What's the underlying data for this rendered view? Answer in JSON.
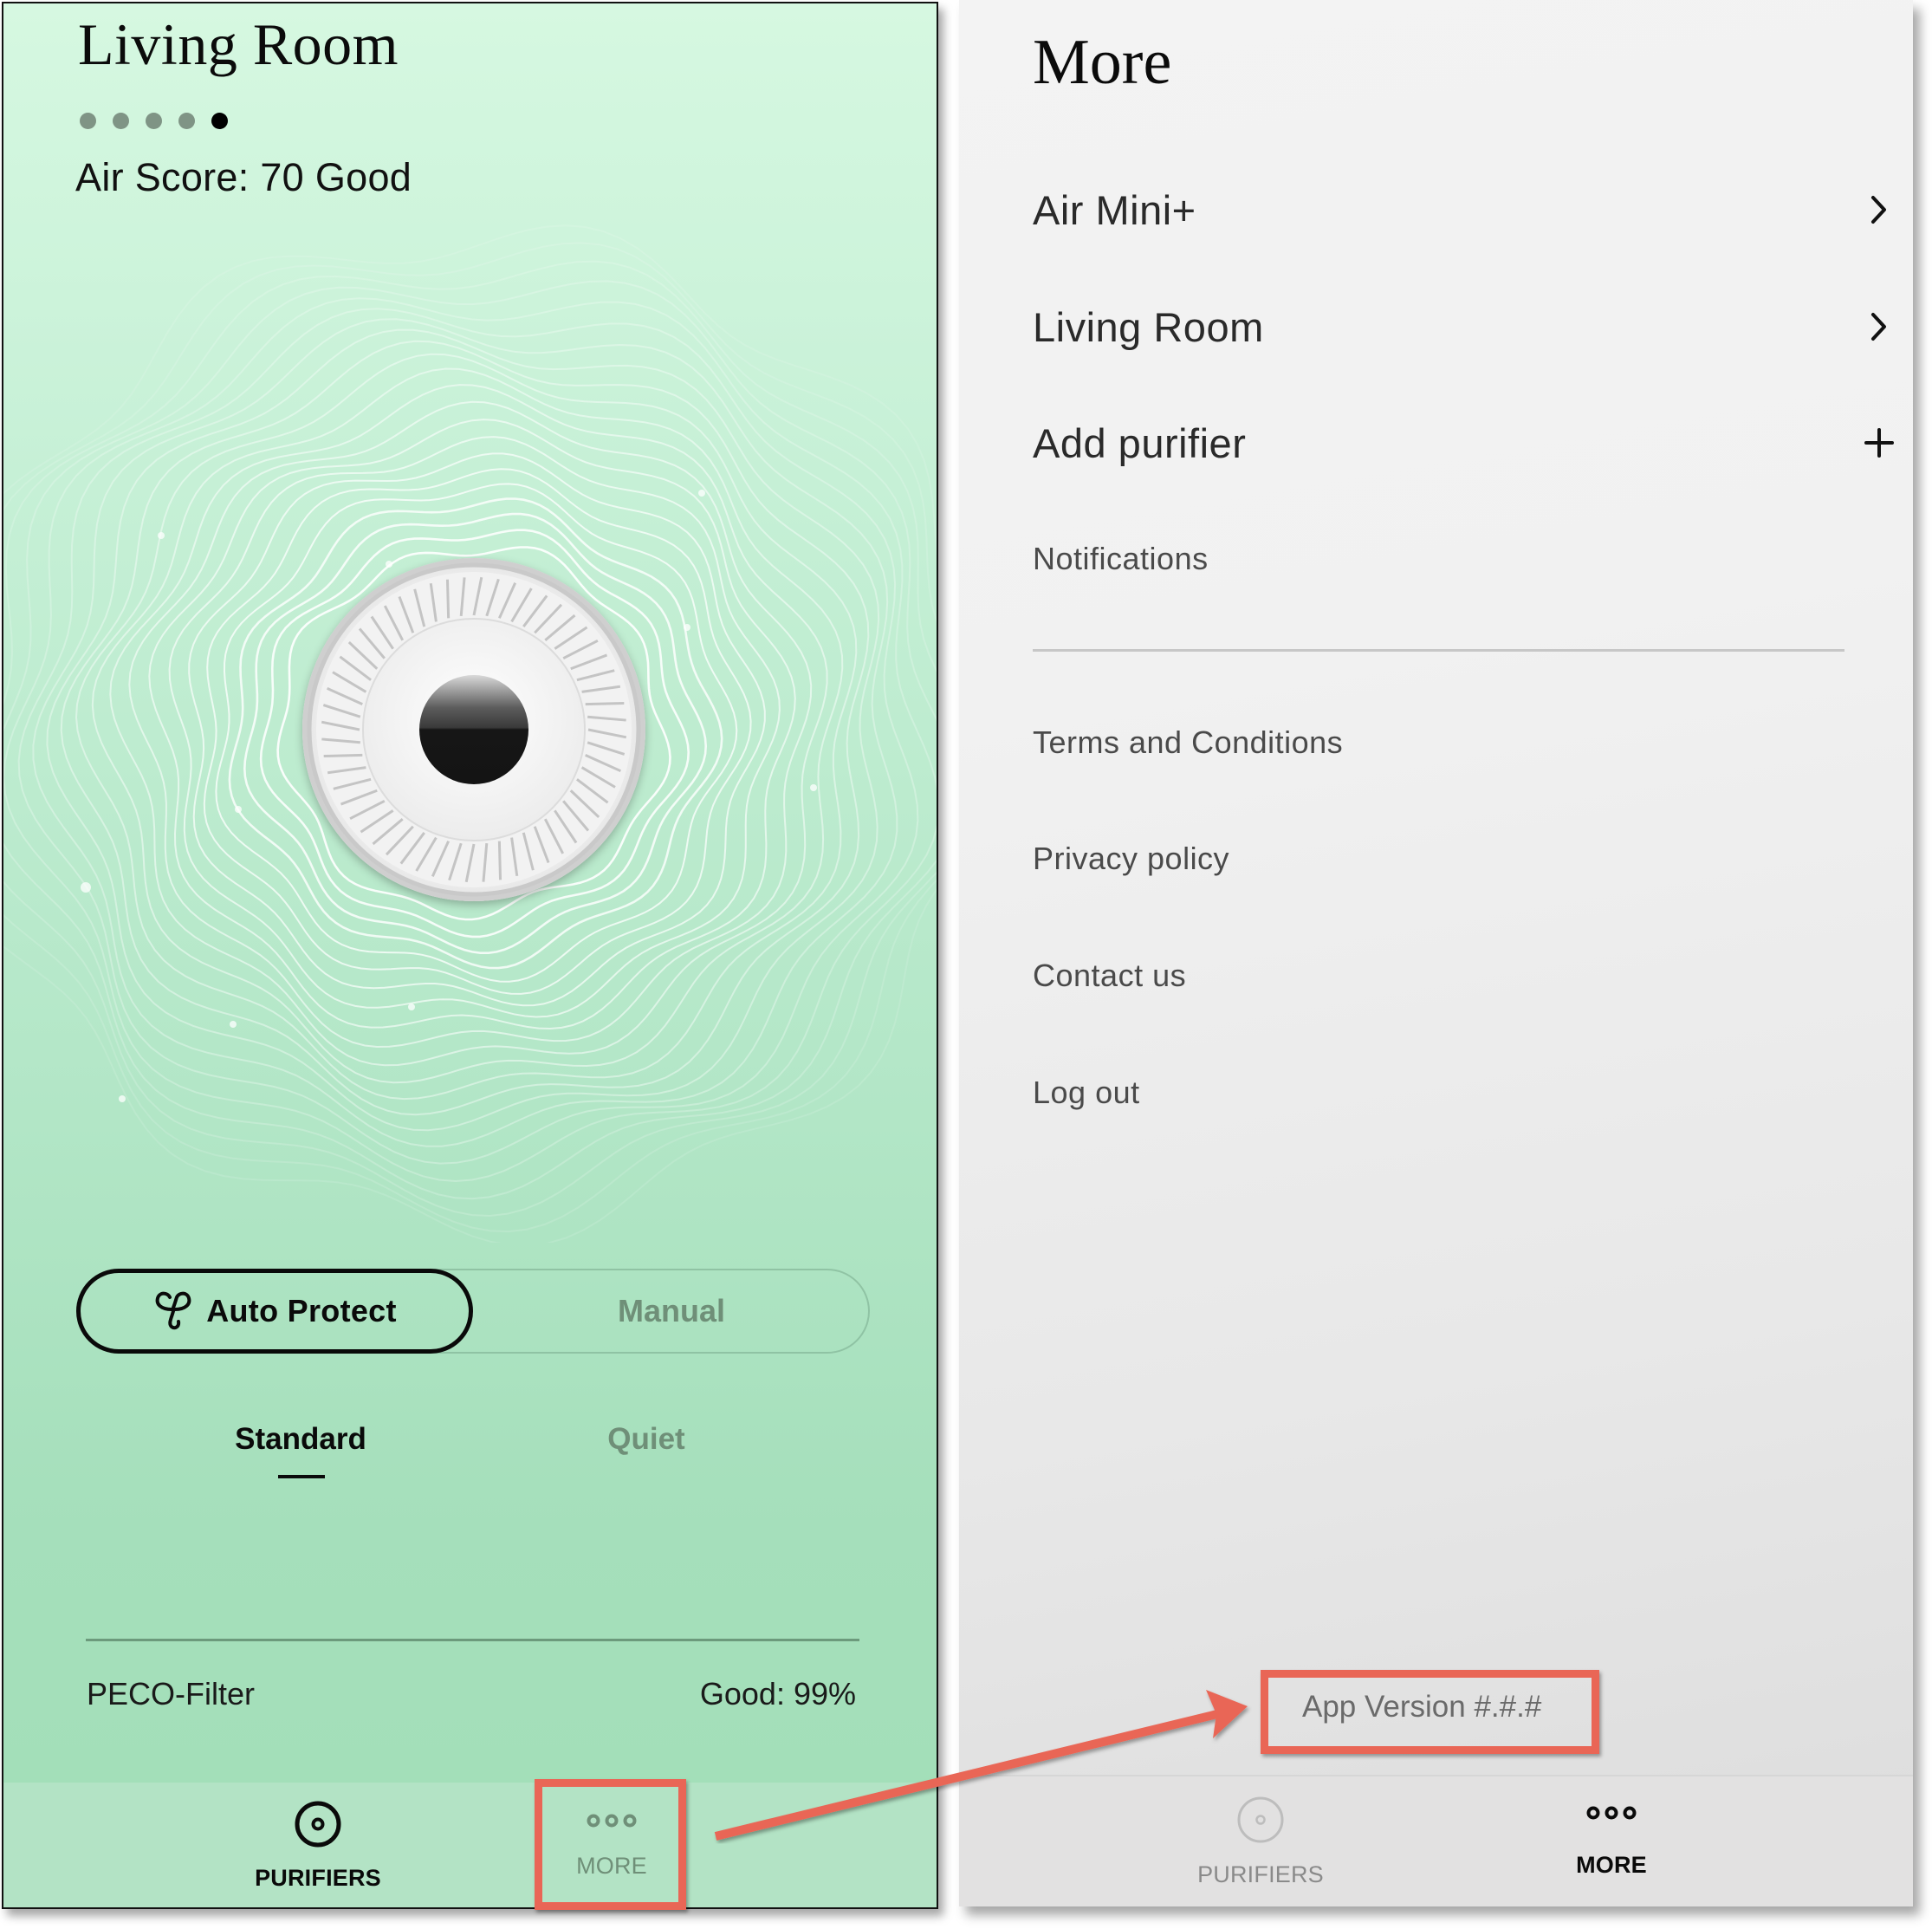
{
  "left_screen": {
    "room_title": "Living Room",
    "page_indicator": {
      "total": 5,
      "active_index": 4
    },
    "air_score_text": "Air Score: 70 Good",
    "air_score": {
      "label": "Air Score",
      "value": 70,
      "rating": "Good"
    },
    "mode_toggle": {
      "options": [
        {
          "label": "Auto Protect",
          "icon": "auto-protect-icon",
          "selected": true
        },
        {
          "label": "Manual",
          "selected": false
        }
      ]
    },
    "fan_tabs": [
      {
        "label": "Standard",
        "selected": true
      },
      {
        "label": "Quiet",
        "selected": false
      }
    ],
    "filter": {
      "name": "PECO-Filter",
      "status": "Good: 99%",
      "percent": 99
    },
    "bottom_nav": [
      {
        "label": "PURIFIERS",
        "icon": "purifier-target-icon",
        "active": true
      },
      {
        "label": "MORE",
        "icon": "more-dots-icon",
        "active": false
      }
    ]
  },
  "right_screen": {
    "title": "More",
    "device_items": [
      {
        "label": "Air Mini+",
        "icon": "chevron-right-icon"
      },
      {
        "label": "Living Room",
        "icon": "chevron-right-icon"
      },
      {
        "label": "Add purifier",
        "icon": "plus-icon"
      },
      {
        "label": "Notifications",
        "icon": ""
      }
    ],
    "info_items": [
      {
        "label": "Terms and Conditions"
      },
      {
        "label": "Privacy policy"
      },
      {
        "label": "Contact us"
      },
      {
        "label": "Log out"
      }
    ],
    "app_version": "App Version #.#.#",
    "bottom_nav": [
      {
        "label": "PURIFIERS",
        "icon": "purifier-target-icon",
        "active": false
      },
      {
        "label": "MORE",
        "icon": "more-dots-icon",
        "active": true
      }
    ]
  },
  "annotations": {
    "highlight_color": "#e96656",
    "callouts": [
      {
        "from": "left MORE tab",
        "to": "App Version #.#.#"
      }
    ]
  },
  "colors": {
    "left_bg_top": "#d6f8e1",
    "left_bg_bottom": "#a2dfb8",
    "left_nav_bg": "#b3e3c5",
    "right_bg": "#f1f1f1",
    "inactive_green_text": "#6f8f78"
  }
}
